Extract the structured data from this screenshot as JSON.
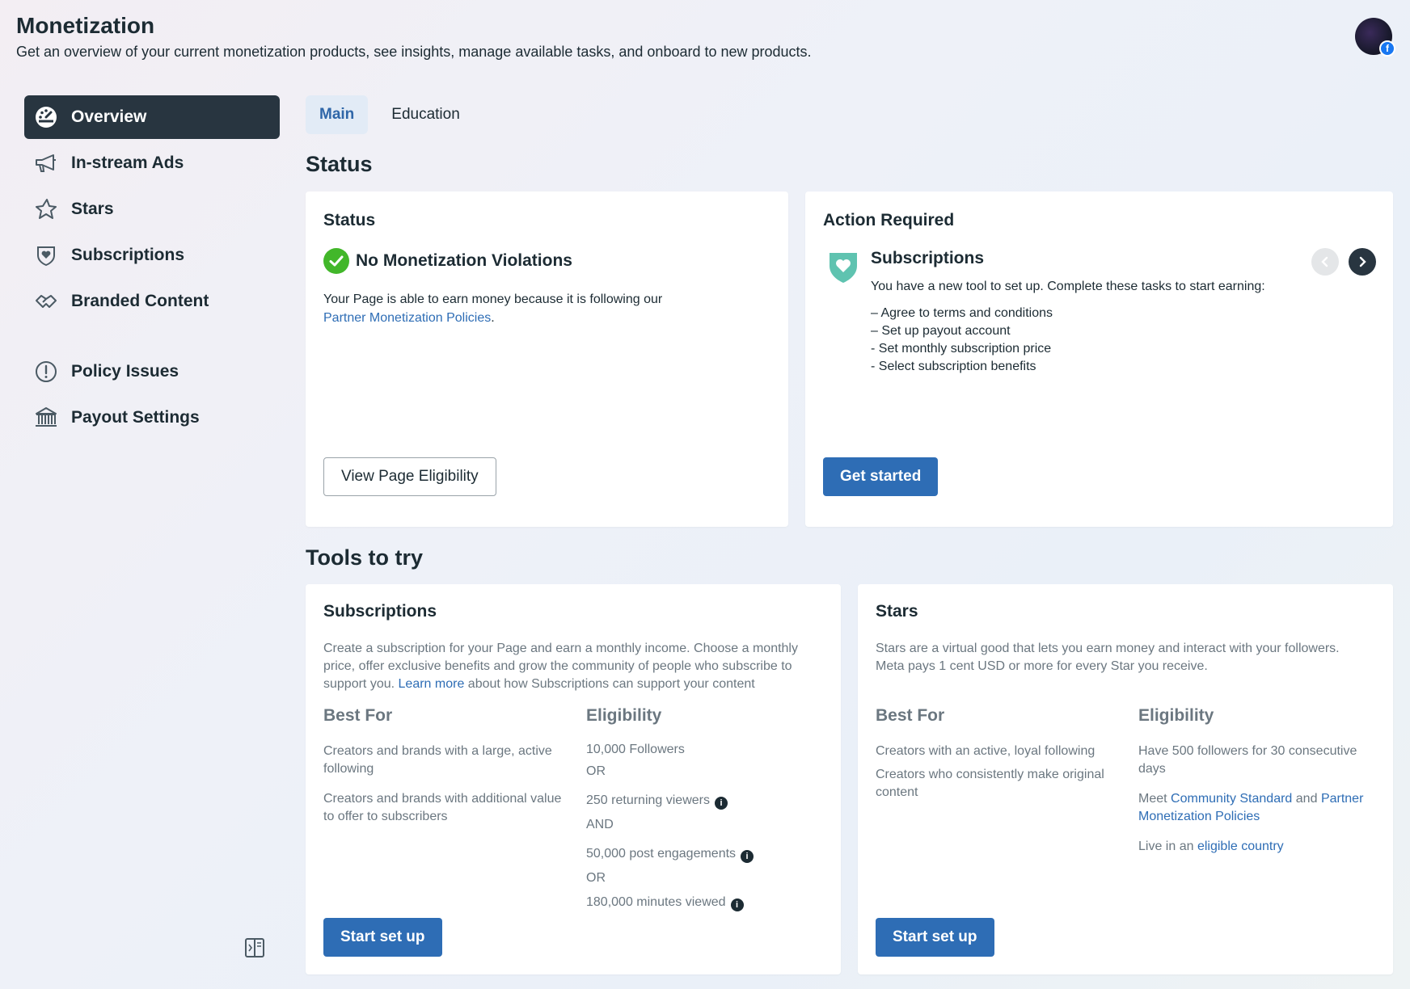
{
  "header": {
    "title": "Monetization",
    "subtitle": "Get an overview of your current monetization products, see insights, manage available tasks, and onboard to new products."
  },
  "sidebar": {
    "items": [
      {
        "label": "Overview",
        "icon": "dashboard-icon"
      },
      {
        "label": "In-stream Ads",
        "icon": "megaphone-icon"
      },
      {
        "label": "Stars",
        "icon": "star-icon"
      },
      {
        "label": "Subscriptions",
        "icon": "shield-heart-icon"
      },
      {
        "label": "Branded Content",
        "icon": "handshake-icon"
      },
      {
        "label": "Policy Issues",
        "icon": "alert-circle-icon"
      },
      {
        "label": "Payout Settings",
        "icon": "bank-icon"
      }
    ]
  },
  "tabs": [
    {
      "label": "Main"
    },
    {
      "label": "Education"
    }
  ],
  "status_section": {
    "heading": "Status",
    "status_card": {
      "title": "Status",
      "headline": "No Monetization Violations",
      "body": "Your Page is able to earn money because it is following our",
      "link": "Partner Monetization Policies",
      "period": ".",
      "button": "View Page Eligibility"
    },
    "action_card": {
      "title": "Action Required",
      "item_title": "Subscriptions",
      "item_desc": "You have a new tool to set up. Complete these tasks to start earning:",
      "tasks": [
        "– Agree to terms and conditions",
        "– Set up payout account",
        "- Set monthly subscription price",
        "- Select subscription benefits"
      ],
      "button": "Get started"
    }
  },
  "tools_section": {
    "heading": "Tools to try",
    "subscriptions": {
      "title": "Subscriptions",
      "desc_1": "Create a subscription for your Page and earn a monthly income. Choose a monthly price, offer exclusive benefits and grow the community of people who subscribe to support you.",
      "desc_link": "Learn more",
      "desc_2": "about how Subscriptions can support your content",
      "best_for_head": "Best For",
      "best_for": [
        "Creators and brands with a large, active following",
        "Creators and brands with additional value to offer to subscribers"
      ],
      "eligibility_head": "Eligibility",
      "eligibility": {
        "followers": "10,000 Followers",
        "or_1": "OR",
        "returning": "250 returning viewers",
        "and": "AND",
        "engagements": "50,000 post engagements",
        "or_2": "OR",
        "minutes": "180,000 minutes viewed"
      },
      "button": "Start set up"
    },
    "stars": {
      "title": "Stars",
      "desc": "Stars are a virtual good that lets you earn money and interact with your followers. Meta pays 1 cent USD or more for every Star you receive.",
      "best_for_head": "Best For",
      "best_for": [
        "Creators with an active, loyal following",
        "Creators who consistently make original content"
      ],
      "eligibility_head": "Eligibility",
      "elig_1": "Have 500 followers for 30 consecutive days",
      "elig_2_pre": "Meet",
      "elig_2_link1": "Community Standard",
      "elig_2_and": "and",
      "elig_2_link2": "Partner Monetization Policies",
      "elig_3_pre": "Live in an",
      "elig_3_link": "eligible country",
      "button": "Start set up"
    }
  },
  "colors": {
    "accent": "#2e6db5",
    "sidebar_active": "#283540",
    "success": "#42b72a",
    "teal": "#5fc3b0"
  }
}
